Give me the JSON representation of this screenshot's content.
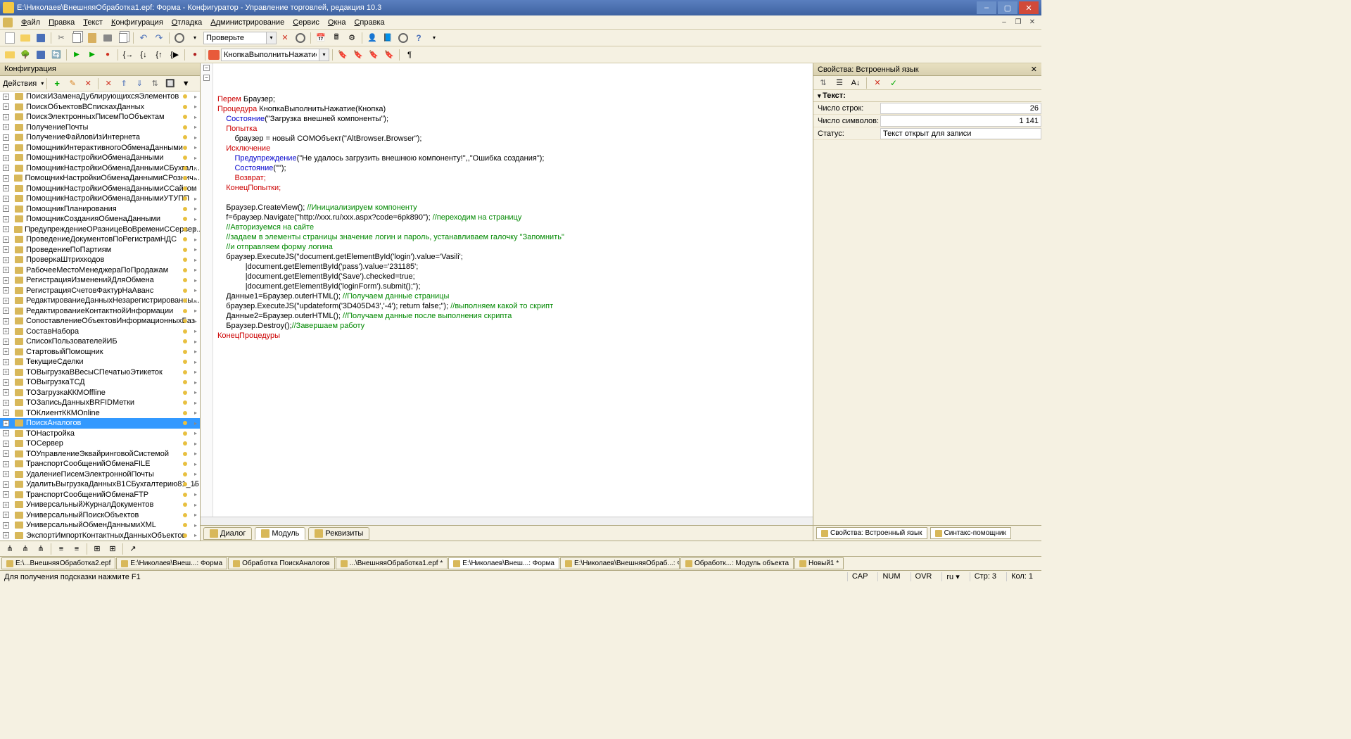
{
  "title": "Е:\\Николаев\\ВнешняяОбработка1.epf: Форма - Конфигуратор - Управление торговлей, редакция 10.3",
  "menu": [
    "Файл",
    "Правка",
    "Текст",
    "Конфигурация",
    "Отладка",
    "Администрирование",
    "Сервис",
    "Окна",
    "Справка"
  ],
  "search_value": "Проверьте",
  "proc_combo": "КнопкаВыполнитьНажатие",
  "sidebar_title": "Конфигурация",
  "actions_label": "Действия",
  "tree_items": [
    "ПоискИЗаменаДублирующихсяЭлементов",
    "ПоискОбъектовВСпискахДанных",
    "ПоискЭлектронныхПисемПоОбъектам",
    "ПолучениеПочты",
    "ПолучениеФайловИзИнтернета",
    "ПомощникИнтерактивногоОбменаДанными",
    "ПомощникНастройкиОбменаДанными",
    "ПомощникНастройкиОбменаДаннымиСБухгал...",
    "ПомощникНастройкиОбменаДаннымиСРознич...",
    "ПомощникНастройкиОбменаДаннымиССайтом",
    "ПомощникНастройкиОбменаДаннымиУТУПП",
    "ПомощникПланирования",
    "ПомощникСозданияОбменаДанными",
    "ПредупреждениеОРазницеВоВремениССервер...",
    "ПроведениеДокументовПоРегистрамНДС",
    "ПроведениеПоПартиям",
    "ПроверкаШтрихкодов",
    "РабочееМестоМенеджераПоПродажам",
    "РегистрацияИзмененийДляОбмена",
    "РегистрацияСчетовФактурНаАванс",
    "РедактированиеДанныхНезарегистрированны...",
    "РедактированиеКонтактнойИнформации",
    "СопоставлениеОбъектовИнформационныхБаз",
    "СоставНабора",
    "СписокПользователейИБ",
    "СтартовыйПомощник",
    "ТекущиеСделки",
    "ТОВыгрузкаВВесыСПечатьюЭтикеток",
    "ТОВыгрузкаТСД",
    "ТОЗагрузкаККМOffline",
    "ТОЗаписьДанныхВRFIDМетки",
    "ТОКлиентККМOnline",
    "ПоискАналогов",
    "ТОНастройка",
    "ТОСервер",
    "ТОУправлениеЭквайринговойСистемой",
    "ТранспортСообщенийОбменаFILE",
    "УдалениеПисемЭлектроннойПочты",
    "УдалитьВыгрузкаДанныхВ1СБухгалтерию81_15",
    "ТранспортСообщенийОбменаFTP",
    "УниверсальныйЖурналДокументов",
    "УниверсальныйПоискОбъектов",
    "УниверсальныйОбменДаннымиXML",
    "ЭкспортИмпортКонтактныхДанныхОбъектов"
  ],
  "selected_index": 32,
  "code_lines": [
    {
      "t": "Перем",
      "c": "kw-red",
      "rest": " Браузер;"
    },
    {
      "t": "Процедура",
      "c": "kw-red",
      "rest": " КнопкаВыполнитьНажатие(Кнопка)",
      "fold": true
    },
    {
      "indent": "    ",
      "method": "Состояние",
      "args": "(\"Загрузка внешней компоненты\");"
    },
    {
      "indent": "    ",
      "t": "Попытка",
      "c": "kw-red"
    },
    {
      "indent": "        ",
      "plain": "браузер = новый COMОбъект(",
      "str": "\"AltBrowser.Browser\"",
      "tail": ");"
    },
    {
      "indent": "    ",
      "t": "Исключение",
      "c": "kw-red"
    },
    {
      "indent": "        ",
      "method": "Предупреждение",
      "args": "(\"Не удалось загрузить внешнюю компоненту!\",,\"Ошибка создания\");"
    },
    {
      "indent": "        ",
      "method": "Состояние",
      "args": "(\"\");"
    },
    {
      "indent": "        ",
      "t": "Возврат;",
      "c": "kw-red"
    },
    {
      "indent": "    ",
      "t": "КонецПопытки;",
      "c": "kw-red"
    },
    {
      "blank": true
    },
    {
      "indent": "    ",
      "call": "Браузер.CreateView",
      "args": "();",
      "cmt": " //Инициализируем компоненту"
    },
    {
      "indent": "    ",
      "plain": "f=браузер.Navigate(",
      "str": "\"http://xxx.ru/xxx.aspx?code=6pk890\"",
      "tail": ");",
      "cmt": " //переходим на страницу"
    },
    {
      "indent": "    ",
      "cmt": "//Авторизуемся на сайте"
    },
    {
      "indent": "    ",
      "cmt": "//задаем в элементы страницы значение логин и пароль, устанавливаем галочку \"Запомнить\""
    },
    {
      "indent": "    ",
      "cmt": "//и отправляем форму логина"
    },
    {
      "indent": "    ",
      "plain": "браузер.ExecuteJS(",
      "str": "\"document.getElementById('login').value='Vasili';",
      "tail": ""
    },
    {
      "indent": "             ",
      "str": "|document.getElementById('pass').value='231185';",
      "tail": ""
    },
    {
      "indent": "             ",
      "str": "|document.getElementById('Save').checked=true;",
      "tail": ""
    },
    {
      "indent": "             ",
      "str": "|document.getElementById('loginForm').submit();\"",
      "tail": ");"
    },
    {
      "indent": "    ",
      "plain": "Данные1=Браузер.outerHTML();",
      "cmt": " //Получаем данные страницы"
    },
    {
      "indent": "    ",
      "plain": "браузер.ExecuteJS(",
      "str": "\"updateform('3D405D43','-4'); return false;\"",
      "tail": ");",
      "cmt": " //выполняем какой то скрипт"
    },
    {
      "indent": "    ",
      "plain": "Данные2=Браузер.outerHTML();",
      "cmt": " //Получаем данные после выполнения скрипта"
    },
    {
      "indent": "    ",
      "call": "Браузер.Destroy",
      "args": "();",
      "cmt2": "//Завершаем работу"
    },
    {
      "t": "КонецПроцедуры",
      "c": "kw-red"
    }
  ],
  "editor_tabs": [
    {
      "label": "Диалог"
    },
    {
      "label": "Модуль",
      "active": true
    },
    {
      "label": "Реквизиты"
    }
  ],
  "props": {
    "title": "Свойства: Встроенный язык",
    "section": "Текст:",
    "rows": [
      {
        "label": "Число строк:",
        "value": "26"
      },
      {
        "label": "Число символов:",
        "value": "1 141"
      },
      {
        "label": "Статус:",
        "value": "Текст открыт для записи",
        "left": true
      }
    ],
    "tabs": [
      "Свойства: Встроенный язык",
      "Синтакс-помощник"
    ]
  },
  "file_tabs": [
    "Е:\\...ВнешняяОбработка2.epf",
    "Е:\\Николаев\\Внеш...: Форма",
    "Обработка ПоискАналогов",
    "...\\ВнешняяОбработка1.epf *",
    "Е:\\Николаев\\Внеш...: Форма",
    "Е:\\Николаев\\ВнешняяОбраб...: Форма",
    "Обработк...: Модуль объекта",
    "Новый1 *"
  ],
  "active_file_tab": 4,
  "status_hint": "Для получения подсказки нажмите F1",
  "status_right": [
    "CAP",
    "NUM",
    "OVR",
    "ru ▾",
    "Стр: 3",
    "Кол: 1"
  ]
}
